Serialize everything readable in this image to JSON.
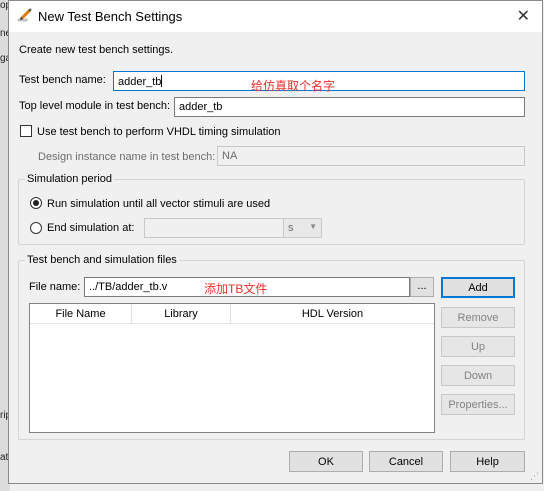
{
  "background_window": {
    "fragments": [
      "op",
      "ne",
      "ga",
      "rip",
      "ati"
    ]
  },
  "dialog": {
    "title": "New Test Bench Settings",
    "close_glyph": "✕",
    "description": "Create new test bench settings.",
    "testbench_name": {
      "label": "Test bench name:",
      "value": "adder_tb"
    },
    "annotation_name": "给仿真取个名字",
    "top_module": {
      "label": "Top level module in test bench:",
      "value": "adder_tb"
    },
    "vhdl_timing": {
      "label": "Use test bench to perform VHDL timing simulation",
      "checked": false
    },
    "design_instance": {
      "label": "Design instance name in test bench:",
      "value": "NA"
    },
    "sim_period": {
      "title": "Simulation period",
      "run_until_label": "Run simulation until all vector stimuli are used",
      "run_until_selected": true,
      "end_at_label": "End simulation at:",
      "end_at_value": "",
      "unit": "s"
    },
    "files": {
      "title": "Test bench and simulation files",
      "file_name_label": "File name:",
      "file_name_value": "../TB/adder_tb.v",
      "annotation": "添加TB文件",
      "browse_label": "...",
      "columns": [
        "File Name",
        "Library",
        "HDL Version"
      ],
      "rows": [],
      "buttons": {
        "add": "Add",
        "remove": "Remove",
        "up": "Up",
        "down": "Down",
        "properties": "Properties..."
      }
    },
    "footer": {
      "ok": "OK",
      "cancel": "Cancel",
      "help": "Help"
    }
  },
  "colors": {
    "accent": "#0078d7",
    "annotation": "#e8312e"
  }
}
